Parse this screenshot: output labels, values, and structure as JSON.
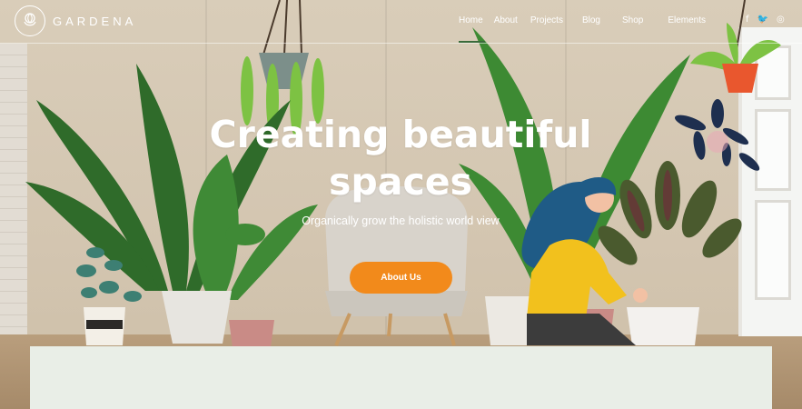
{
  "brand": {
    "name": "GARDENA",
    "logo_icon": "rose-icon"
  },
  "nav": {
    "items": [
      {
        "label": "Home",
        "active": true
      },
      {
        "label": "About",
        "active": false
      },
      {
        "label": "Projects",
        "active": false
      },
      {
        "label": "Blog",
        "active": false
      },
      {
        "label": "Shop",
        "active": false
      },
      {
        "label": "Elements",
        "active": false
      }
    ]
  },
  "social": {
    "facebook": "f",
    "twitter": "🐦",
    "instagram": "◎"
  },
  "hero": {
    "title_line1": "Creating beautiful",
    "title_line2": "spaces",
    "subtitle": "Organically grow the holistic world view",
    "cta_label": "About Us"
  },
  "colors": {
    "accent": "#f28a1b",
    "nav_active_underline": "#3a6b3a",
    "panel": "#e9eee7"
  }
}
